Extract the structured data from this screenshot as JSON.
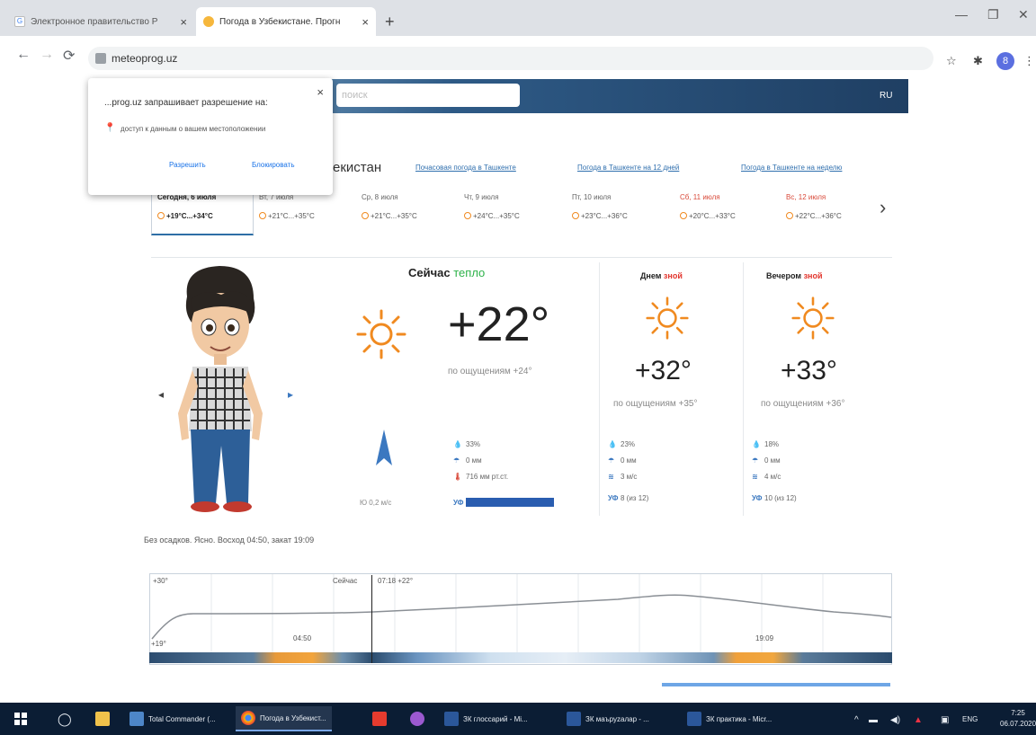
{
  "browser": {
    "tabs": [
      {
        "title": "Электронное правительство Р",
        "close": "×"
      },
      {
        "title": "Погода в Узбекистане. Прогн",
        "close": "×"
      }
    ],
    "new_tab": "+",
    "url": "meteoprog.uz",
    "window": {
      "minimize": "—",
      "maximize": "❐",
      "close": "✕"
    },
    "profile_initial": "8"
  },
  "popup": {
    "message": "...prog.uz запрашивает разрешение на:",
    "permission": "доступ к данным о вашем местоположении",
    "allow": "Разрешить",
    "block": "Блокировать",
    "close": "×"
  },
  "header": {
    "search_placeholder": "поиск",
    "right_text": "RU"
  },
  "city": {
    "name": "екистан",
    "links": [
      "Почасовая погода в Ташкенте",
      "Погода в Ташкенте на 12 дней",
      "Погода в Ташкенте на неделю"
    ]
  },
  "days": [
    {
      "date": "Сегодня, 6 июля",
      "temp": "+19°C...+34°C",
      "today": true
    },
    {
      "date": "Вт, 7 июля",
      "temp": "+21°C...+35°C",
      "weekend": false
    },
    {
      "date": "Ср, 8 июля",
      "temp": "+21°C...+35°C",
      "weekend": false
    },
    {
      "date": "Чт, 9 июля",
      "temp": "+24°C...+35°C",
      "weekend": false
    },
    {
      "date": "Пт, 10 июля",
      "temp": "+23°C...+36°C",
      "weekend": false
    },
    {
      "date": "Сб, 11 июля",
      "temp": "+20°C...+33°C",
      "weekend": true
    },
    {
      "date": "Вс, 12 июля",
      "temp": "+22°C...+36°C",
      "weekend": true
    }
  ],
  "now": {
    "title": "Сейчас",
    "condition": "тепло",
    "temp": "+22°",
    "feels": "по ощущениям +24°",
    "wind": "Ю 0,2 м/с",
    "humidity": "33%",
    "precip": "0 мм",
    "pressure": "716 мм рт.ст.",
    "uv": "УФ"
  },
  "day": {
    "title": "Днем",
    "condition": "зной",
    "temp": "+32°",
    "feels": "по ощущениям +35°",
    "humidity": "23%",
    "precip": "0 мм",
    "wind": "3 м/с",
    "uv": "8 (из 12)"
  },
  "evening": {
    "title": "Вечером",
    "condition": "зной",
    "temp": "+33°",
    "feels": "по ощущениям +36°",
    "humidity": "18%",
    "precip": "0 мм",
    "wind": "4 м/с",
    "uv": "10 (из 12)"
  },
  "sun_info": "Без осадков. Ясно. Восход 04:50, закат 19:09",
  "chart": {
    "top_left": "+30°",
    "now_label": "Сейчас",
    "now_value": "07:18 +22°",
    "bottom_left": "+19°",
    "sunrise": "04:50",
    "sunset": "19:09"
  },
  "taskbar": {
    "items": [
      {
        "label": "Total Commander (..."
      },
      {
        "label": "Погода в Узбекист..."
      },
      {
        "label": "ЗК глоссарий - Mi..."
      },
      {
        "label": "ЗК маъруzалар - ..."
      },
      {
        "label": "ЗК практика - Micr..."
      }
    ],
    "clock_time": "7:25",
    "clock_date": "06.07.2020",
    "lang": "ENG"
  },
  "colors": {
    "accent_blue": "#2e6ea6",
    "warm_green": "#2eb24a",
    "hot_red": "#e2342c",
    "sun_orange": "#f08a20"
  }
}
